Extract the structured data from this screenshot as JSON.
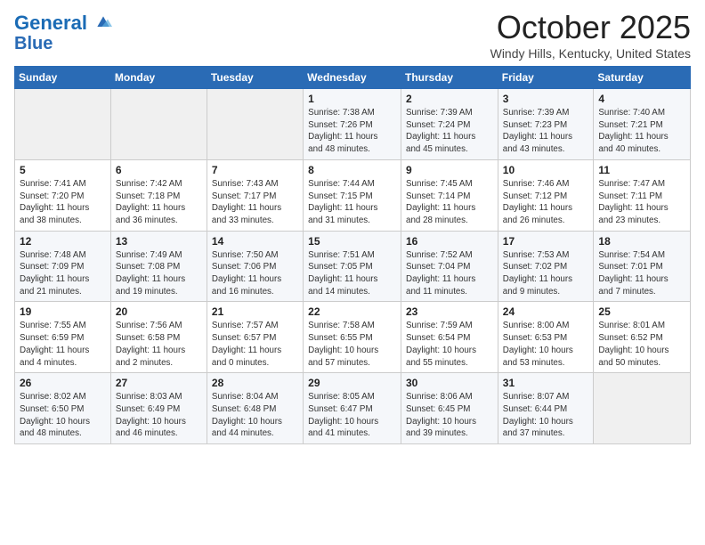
{
  "header": {
    "logo_line1": "General",
    "logo_line2": "Blue",
    "month": "October 2025",
    "location": "Windy Hills, Kentucky, United States"
  },
  "weekdays": [
    "Sunday",
    "Monday",
    "Tuesday",
    "Wednesday",
    "Thursday",
    "Friday",
    "Saturday"
  ],
  "weeks": [
    [
      {
        "num": "",
        "info": ""
      },
      {
        "num": "",
        "info": ""
      },
      {
        "num": "",
        "info": ""
      },
      {
        "num": "1",
        "info": "Sunrise: 7:38 AM\nSunset: 7:26 PM\nDaylight: 11 hours\nand 48 minutes."
      },
      {
        "num": "2",
        "info": "Sunrise: 7:39 AM\nSunset: 7:24 PM\nDaylight: 11 hours\nand 45 minutes."
      },
      {
        "num": "3",
        "info": "Sunrise: 7:39 AM\nSunset: 7:23 PM\nDaylight: 11 hours\nand 43 minutes."
      },
      {
        "num": "4",
        "info": "Sunrise: 7:40 AM\nSunset: 7:21 PM\nDaylight: 11 hours\nand 40 minutes."
      }
    ],
    [
      {
        "num": "5",
        "info": "Sunrise: 7:41 AM\nSunset: 7:20 PM\nDaylight: 11 hours\nand 38 minutes."
      },
      {
        "num": "6",
        "info": "Sunrise: 7:42 AM\nSunset: 7:18 PM\nDaylight: 11 hours\nand 36 minutes."
      },
      {
        "num": "7",
        "info": "Sunrise: 7:43 AM\nSunset: 7:17 PM\nDaylight: 11 hours\nand 33 minutes."
      },
      {
        "num": "8",
        "info": "Sunrise: 7:44 AM\nSunset: 7:15 PM\nDaylight: 11 hours\nand 31 minutes."
      },
      {
        "num": "9",
        "info": "Sunrise: 7:45 AM\nSunset: 7:14 PM\nDaylight: 11 hours\nand 28 minutes."
      },
      {
        "num": "10",
        "info": "Sunrise: 7:46 AM\nSunset: 7:12 PM\nDaylight: 11 hours\nand 26 minutes."
      },
      {
        "num": "11",
        "info": "Sunrise: 7:47 AM\nSunset: 7:11 PM\nDaylight: 11 hours\nand 23 minutes."
      }
    ],
    [
      {
        "num": "12",
        "info": "Sunrise: 7:48 AM\nSunset: 7:09 PM\nDaylight: 11 hours\nand 21 minutes."
      },
      {
        "num": "13",
        "info": "Sunrise: 7:49 AM\nSunset: 7:08 PM\nDaylight: 11 hours\nand 19 minutes."
      },
      {
        "num": "14",
        "info": "Sunrise: 7:50 AM\nSunset: 7:06 PM\nDaylight: 11 hours\nand 16 minutes."
      },
      {
        "num": "15",
        "info": "Sunrise: 7:51 AM\nSunset: 7:05 PM\nDaylight: 11 hours\nand 14 minutes."
      },
      {
        "num": "16",
        "info": "Sunrise: 7:52 AM\nSunset: 7:04 PM\nDaylight: 11 hours\nand 11 minutes."
      },
      {
        "num": "17",
        "info": "Sunrise: 7:53 AM\nSunset: 7:02 PM\nDaylight: 11 hours\nand 9 minutes."
      },
      {
        "num": "18",
        "info": "Sunrise: 7:54 AM\nSunset: 7:01 PM\nDaylight: 11 hours\nand 7 minutes."
      }
    ],
    [
      {
        "num": "19",
        "info": "Sunrise: 7:55 AM\nSunset: 6:59 PM\nDaylight: 11 hours\nand 4 minutes."
      },
      {
        "num": "20",
        "info": "Sunrise: 7:56 AM\nSunset: 6:58 PM\nDaylight: 11 hours\nand 2 minutes."
      },
      {
        "num": "21",
        "info": "Sunrise: 7:57 AM\nSunset: 6:57 PM\nDaylight: 11 hours\nand 0 minutes."
      },
      {
        "num": "22",
        "info": "Sunrise: 7:58 AM\nSunset: 6:55 PM\nDaylight: 10 hours\nand 57 minutes."
      },
      {
        "num": "23",
        "info": "Sunrise: 7:59 AM\nSunset: 6:54 PM\nDaylight: 10 hours\nand 55 minutes."
      },
      {
        "num": "24",
        "info": "Sunrise: 8:00 AM\nSunset: 6:53 PM\nDaylight: 10 hours\nand 53 minutes."
      },
      {
        "num": "25",
        "info": "Sunrise: 8:01 AM\nSunset: 6:52 PM\nDaylight: 10 hours\nand 50 minutes."
      }
    ],
    [
      {
        "num": "26",
        "info": "Sunrise: 8:02 AM\nSunset: 6:50 PM\nDaylight: 10 hours\nand 48 minutes."
      },
      {
        "num": "27",
        "info": "Sunrise: 8:03 AM\nSunset: 6:49 PM\nDaylight: 10 hours\nand 46 minutes."
      },
      {
        "num": "28",
        "info": "Sunrise: 8:04 AM\nSunset: 6:48 PM\nDaylight: 10 hours\nand 44 minutes."
      },
      {
        "num": "29",
        "info": "Sunrise: 8:05 AM\nSunset: 6:47 PM\nDaylight: 10 hours\nand 41 minutes."
      },
      {
        "num": "30",
        "info": "Sunrise: 8:06 AM\nSunset: 6:45 PM\nDaylight: 10 hours\nand 39 minutes."
      },
      {
        "num": "31",
        "info": "Sunrise: 8:07 AM\nSunset: 6:44 PM\nDaylight: 10 hours\nand 37 minutes."
      },
      {
        "num": "",
        "info": ""
      }
    ]
  ]
}
